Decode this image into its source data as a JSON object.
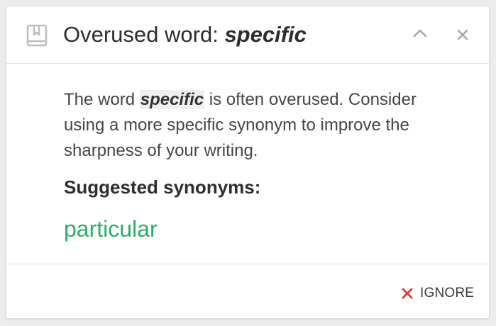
{
  "header": {
    "title_prefix": "Overused word: ",
    "title_word": "specific",
    "icon": "book-icon",
    "collapse_icon": "chevron-up-icon",
    "close_icon": "close-icon"
  },
  "body": {
    "description_before": "The word ",
    "description_word": "specific",
    "description_after": " is often overused. Consider using a more specific synonym to improve the sharpness of your writing.",
    "synonyms_heading": "Suggested synonyms:",
    "synonyms": [
      "particular"
    ]
  },
  "footer": {
    "ignore_label": "IGNORE",
    "ignore_icon": "x-icon"
  },
  "colors": {
    "synonym": "#2aae6a",
    "ignore_icon": "#e0393e",
    "icon_gray": "#bdbdbd",
    "text": "#2d2d2d"
  }
}
